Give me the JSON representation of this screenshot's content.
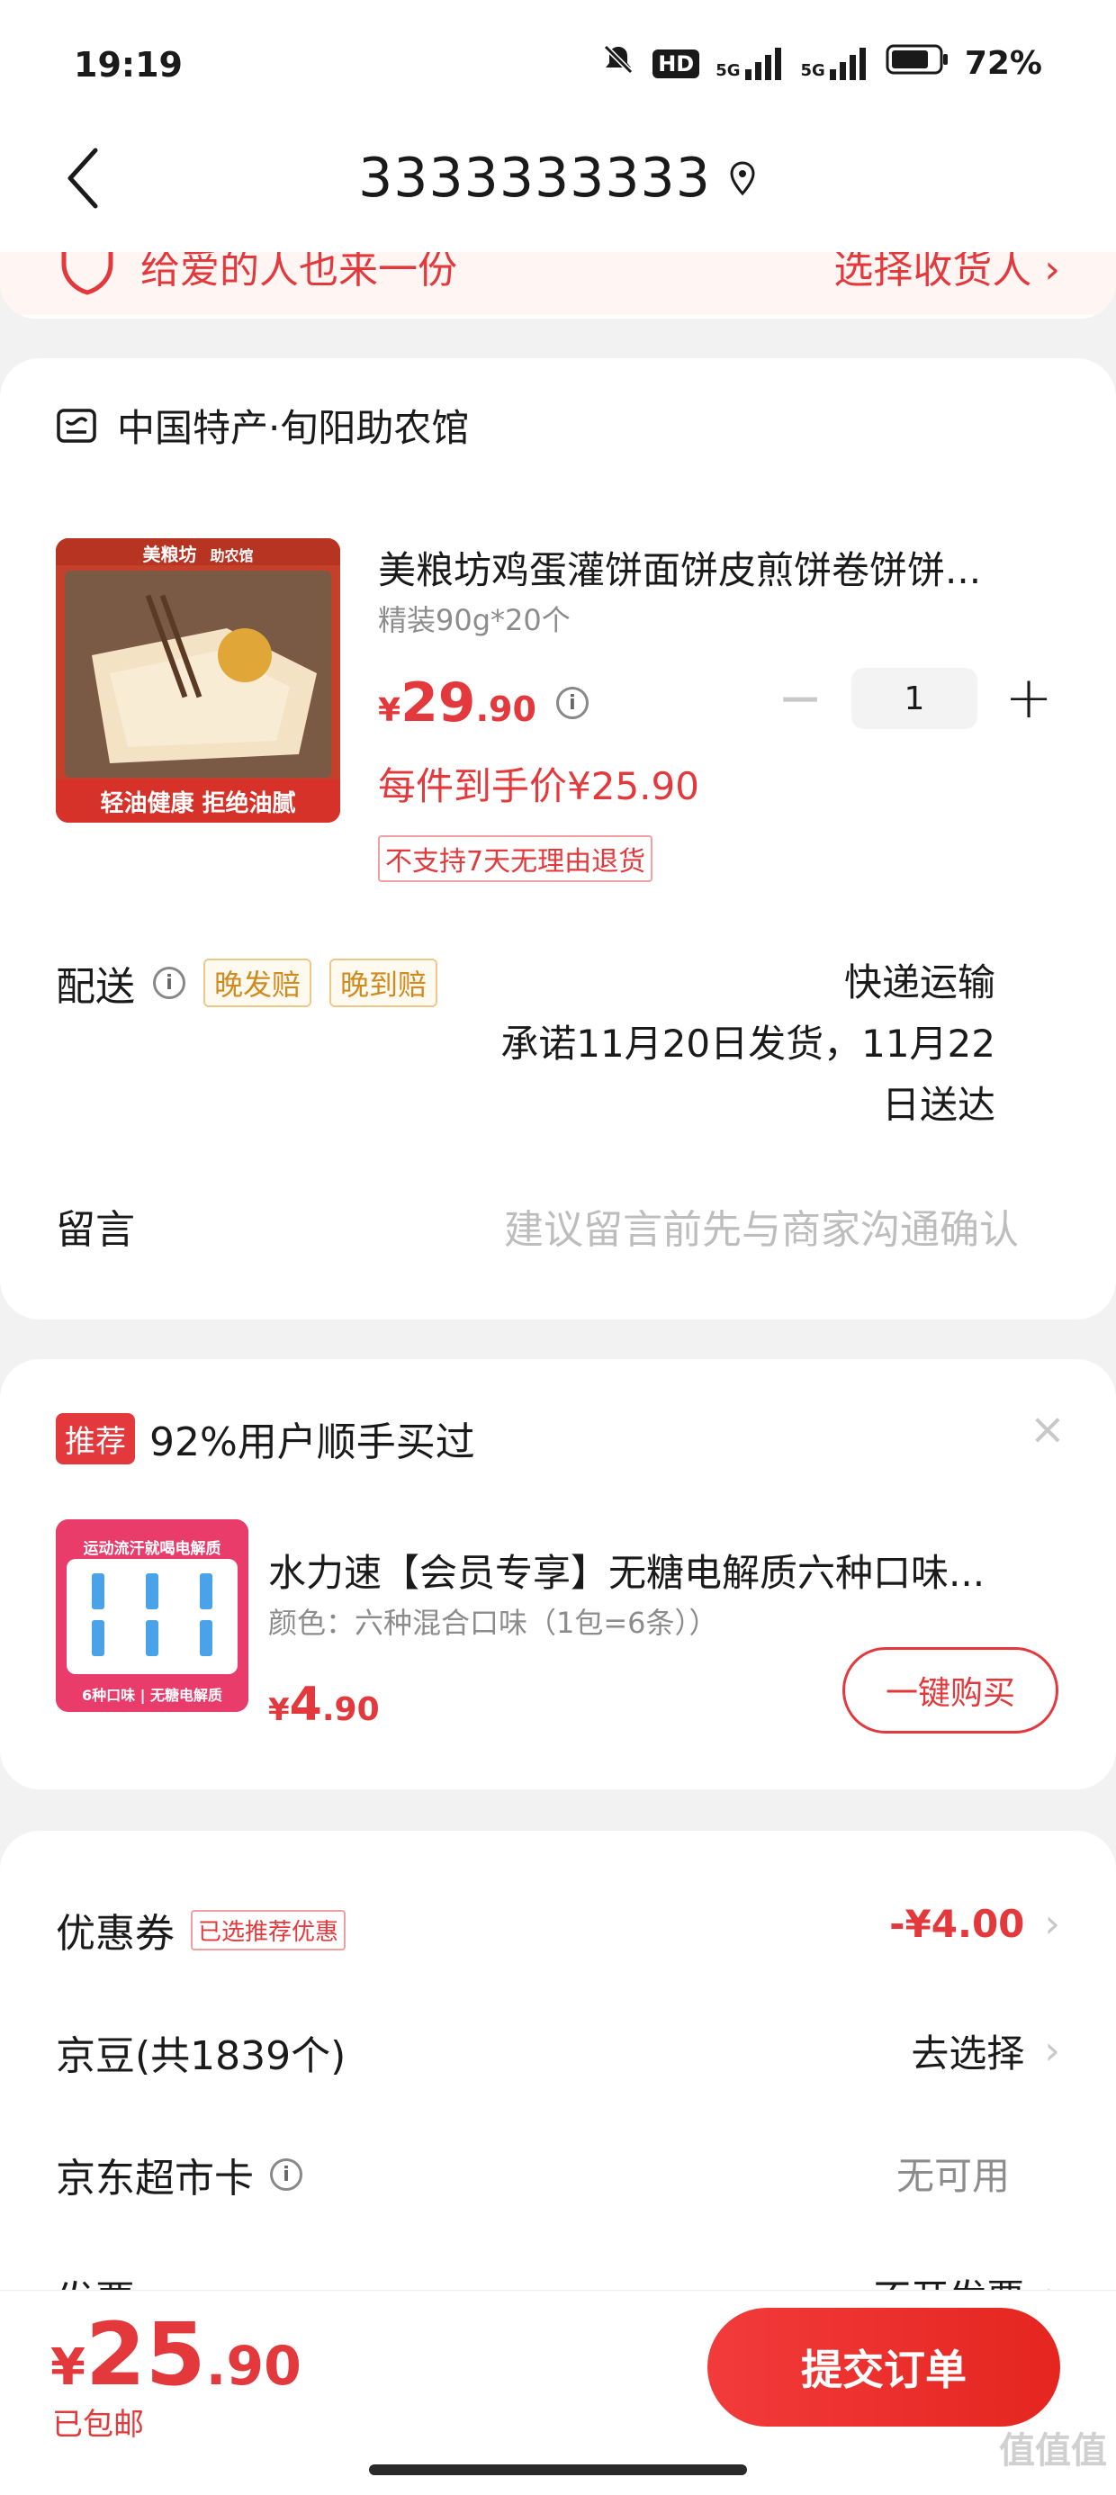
{
  "status_bar": {
    "time": "19:19",
    "battery": "72%",
    "network_1": "5G",
    "network_2": "5G",
    "hd": "HD"
  },
  "nav": {
    "title": "3333333333"
  },
  "address_strip": {
    "left_text": "给爱的人也来一份",
    "right_text": "选择收货人 ›"
  },
  "shop": {
    "name": "中国特产·旬阳助农馆"
  },
  "product": {
    "title": "美粮坊鸡蛋灌饼面饼皮煎饼卷饼饼...",
    "spec": "精装90g*20个",
    "price_symbol": "¥",
    "price_int": "29",
    "price_dec": ".90",
    "quantity": "1",
    "deal_price": "每件到手价¥25.90",
    "no_return": "不支持7天无理由退货",
    "image_brand": "美粮坊",
    "image_tag": "助农馆",
    "image_slogan": "轻油健康 拒绝油腻"
  },
  "delivery": {
    "label": "配送",
    "tags": [
      "晚发赔",
      "晚到赔"
    ],
    "method": "快递运输",
    "promise_line1": "承诺11月20日发货，11月22",
    "promise_line2": "日送达"
  },
  "message": {
    "label": "留言",
    "placeholder": "建议留言前先与商家沟通确认"
  },
  "recommend": {
    "badge": "推荐",
    "headline": "92%用户顺手买过",
    "close": "×",
    "title": "水力速【会员专享】无糖电解质六种口味...",
    "spec": "颜色：六种混合口味（1包=6条））",
    "price_symbol": "¥",
    "price_int": "4",
    "price_dec": ".90",
    "buy_label": "一键购买",
    "image_top": "运动流汗就喝电解质",
    "image_bottom": "6种口味 | 无糖电解质"
  },
  "summary": {
    "coupon_label": "优惠券",
    "coupon_tag": "已选推荐优惠",
    "coupon_value": "-¥4.00",
    "jd_beans_label": "京豆(共1839个)",
    "jd_beans_value": "去选择",
    "market_card_label": "京东超市卡",
    "market_card_value": "无可用",
    "partial_label": "发票",
    "partial_value": "不开发票"
  },
  "bottom": {
    "total_symbol": "¥",
    "total_int": "25",
    "total_dec": ".90",
    "shipping": "已包邮",
    "submit": "提交订单"
  },
  "watermark": "值值值",
  "colors": {
    "accent": "#e4393c",
    "tag_yellow": "#d08a1e"
  }
}
